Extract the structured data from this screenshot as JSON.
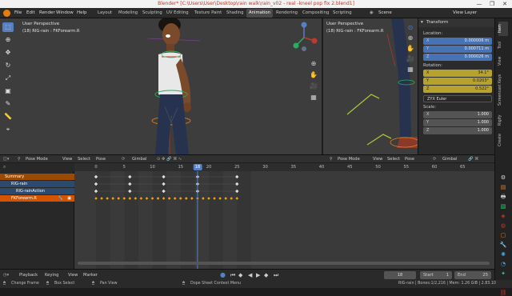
{
  "window": {
    "title": "Blender* [C:\\Users\\User\\Desktop\\rain walk\\rain_v02 - real -kneel pop fix 2.blend1]",
    "minimize": "—",
    "maximize": "❐",
    "close": "✕"
  },
  "menu": [
    "File",
    "Edit",
    "Render",
    "Window",
    "Help"
  ],
  "workspaces": [
    "Layout",
    "Modeling",
    "Sculpting",
    "UV Editing",
    "Texture Paint",
    "Shading",
    "Animation",
    "Rendering",
    "Compositing",
    "Scripting"
  ],
  "active_workspace": "Animation",
  "scene": {
    "label": "Scene",
    "view_layer": "View Layer"
  },
  "viewport_main": {
    "mode": "Pose Mode",
    "menus": [
      "View",
      "Select",
      "Pose"
    ],
    "orientation": "Gimbal",
    "title": "User Perspective",
    "subtitle": "(18) RIG-rain : FKForearm.R"
  },
  "viewport_side": {
    "title": "User Perspective",
    "subtitle": "(18) RIG-rain : FKForearm.R",
    "mode": "Pose Mode",
    "menus": [
      "View",
      "Select",
      "Pose"
    ],
    "orientation": "Gimbal"
  },
  "npanel": {
    "header": "Transform",
    "location_label": "Location:",
    "location": [
      {
        "axis": "X",
        "value": "0.000006 m"
      },
      {
        "axis": "Y",
        "value": "0.000711 m"
      },
      {
        "axis": "Z",
        "value": "0.000026 m"
      }
    ],
    "rotation_label": "Rotation:",
    "rotation": [
      {
        "axis": "X",
        "value": "34.1°"
      },
      {
        "axis": "Y",
        "value": "0.0203°"
      },
      {
        "axis": "Z",
        "value": "0.522°"
      }
    ],
    "rotation_mode": "ZYX Euler",
    "scale_label": "Scale:",
    "scale": [
      {
        "axis": "X",
        "value": "1.000"
      },
      {
        "axis": "Y",
        "value": "1.000"
      },
      {
        "axis": "Z",
        "value": "1.000"
      }
    ]
  },
  "side_tabs": [
    "Item",
    "Tool",
    "View",
    "Screencast Keys",
    "Rigify",
    "Create"
  ],
  "dopesheet": {
    "mode": "Pose Mode",
    "menus": [
      "View",
      "Select",
      "Pose"
    ],
    "orientation": "Gimbal",
    "ruler_ticks": [
      "0",
      "5",
      "10",
      "15",
      "20",
      "25",
      "30",
      "35",
      "40",
      "45",
      "50",
      "55",
      "60",
      "65"
    ],
    "current_frame": "18",
    "channels": [
      {
        "label": "Summary"
      },
      {
        "label": "RIG-rain"
      },
      {
        "label": "RIG-rainAction"
      },
      {
        "label": "FKForearm.R"
      }
    ],
    "summary_keys": [
      0,
      6,
      12,
      18,
      25
    ],
    "action_keys": [
      0,
      6,
      12,
      18,
      25
    ],
    "bone_keys": [
      0,
      1,
      2,
      3,
      4,
      5,
      6,
      7,
      8,
      9,
      10,
      11,
      12,
      13,
      14,
      15,
      16,
      17,
      18,
      19,
      20,
      21,
      22,
      23,
      24,
      25
    ],
    "rig_keys": [
      0,
      6,
      12,
      18,
      25
    ]
  },
  "playback": {
    "playback_label": "Playback",
    "keying_label": "Keying",
    "view_label": "View",
    "marker_label": "Marker",
    "frame": "18",
    "start_label": "Start",
    "start": "1",
    "end_label": "End",
    "end": "25"
  },
  "status": {
    "change_frame": "Change Frame",
    "box_select": "Box Select",
    "pan_view": "Pan View",
    "context_menu": "Dope Sheet Context Menu",
    "info": "RIG-rain | Bones:1/2,216 | Mem: 1.26 GiB | 2.83.10"
  },
  "colors": {
    "accent_blue": "#4772b3",
    "keyframe_orange": "#e8a317",
    "selection_orange": "#d35400",
    "playhead": "#5680c2",
    "animated_field": "#b8a22e"
  }
}
